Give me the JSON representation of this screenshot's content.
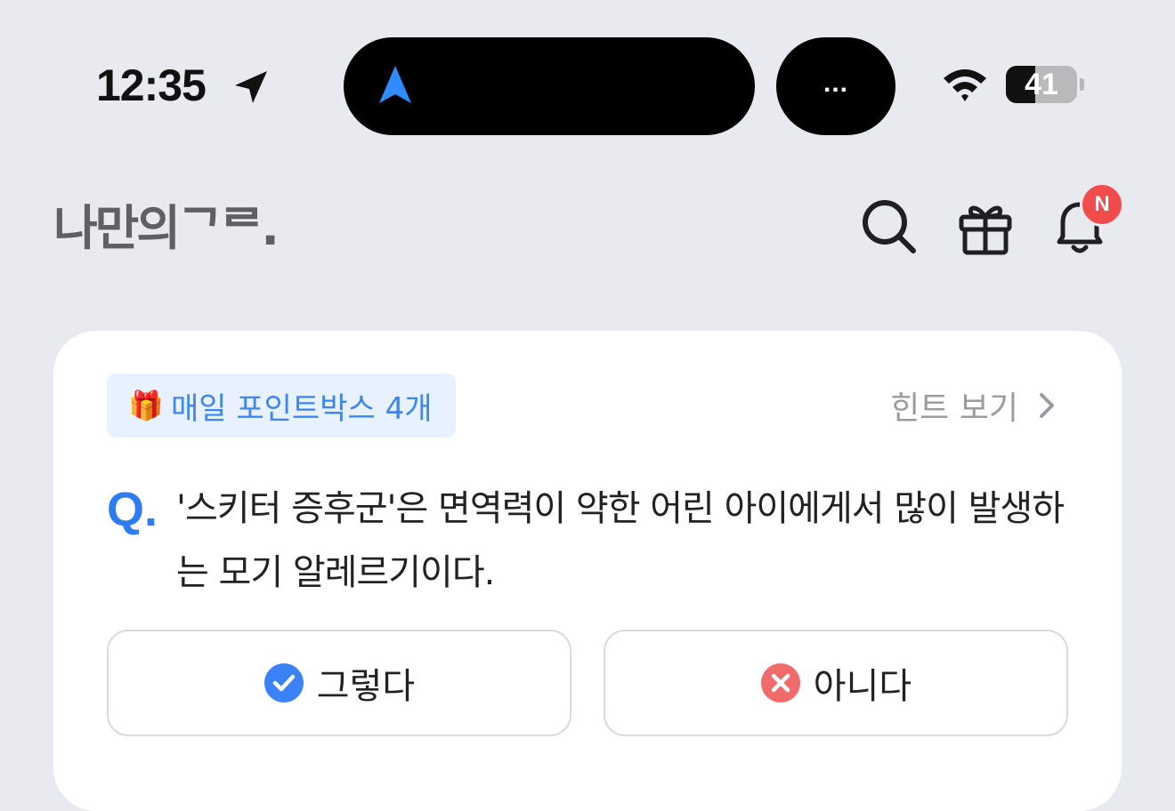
{
  "status_bar": {
    "time": "12:35",
    "island_more": "...",
    "battery_level": "41",
    "battery_fraction": 0.41,
    "icons": [
      "location-arrow-icon",
      "navigation-icon",
      "wifi-icon",
      "battery-icon"
    ]
  },
  "header": {
    "logo": "나만의ᄀᄅ.",
    "notification_badge": "N",
    "icons": [
      "search-icon",
      "gift-icon",
      "bell-icon"
    ]
  },
  "quiz": {
    "reward_emoji": "🎁",
    "reward_label": "매일 포인트박스 4개",
    "hint_label": "힌트 보기",
    "q_mark": "Q.",
    "question": "'스키터 증후군'은 면역력이 약한 어린 아이에게서 많이 발생하는 모기 알레르기이다.",
    "yes_label": "그렇다",
    "no_label": "아니다"
  },
  "colors": {
    "background": "#e9eaef",
    "accent_blue": "#2f7bf0",
    "pill_bg": "#e8f1ff",
    "yes_icon": "#3b82f6",
    "no_icon": "#f26b6b",
    "badge": "#f24b4b"
  }
}
